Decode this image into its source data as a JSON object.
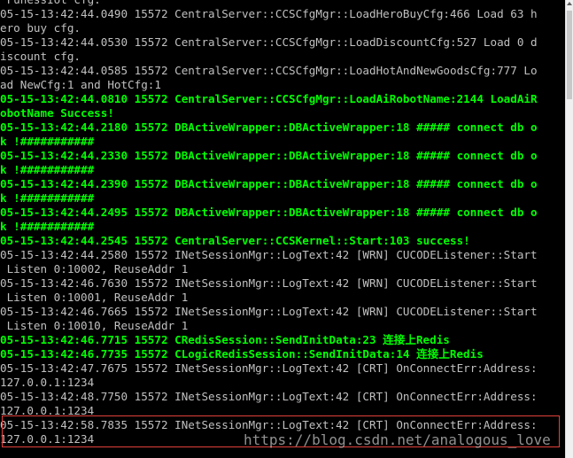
{
  "console": {
    "lines": [
      {
        "text": " FunessIot cfg.",
        "color": "gray"
      },
      {
        "text": "05-15-13:42:44.0490 15572 CentralServer::CCSCfgMgr::LoadHeroBuyCfg:466 Load 63 h",
        "color": "gray"
      },
      {
        "text": "ero buy cfg.",
        "color": "gray"
      },
      {
        "text": "05-15-13:42:44.0530 15572 CentralServer::CCSCfgMgr::LoadDiscountCfg:527 Load 0 d",
        "color": "gray"
      },
      {
        "text": "iscount cfg.",
        "color": "gray"
      },
      {
        "text": "05-15-13:42:44.0585 15572 CentralServer::CCSCfgMgr::LoadHotAndNewGoodsCfg:777 Lo",
        "color": "gray"
      },
      {
        "text": "ad NewCfg:1 and HotCfg:1",
        "color": "gray"
      },
      {
        "text": "05-15-13:42:44.0810 15572 CentralServer::CCSCfgMgr::LoadAiRobotName:2144 LoadAiR",
        "color": "green"
      },
      {
        "text": "obotName Success!",
        "color": "green"
      },
      {
        "text": "05-15-13:42:44.2180 15572 DBActiveWrapper::DBActiveWrapper:18 ##### connect db o",
        "color": "green"
      },
      {
        "text": "k !###########",
        "color": "green"
      },
      {
        "text": "05-15-13:42:44.2330 15572 DBActiveWrapper::DBActiveWrapper:18 ##### connect db o",
        "color": "green"
      },
      {
        "text": "k !###########",
        "color": "green"
      },
      {
        "text": "05-15-13:42:44.2390 15572 DBActiveWrapper::DBActiveWrapper:18 ##### connect db o",
        "color": "green"
      },
      {
        "text": "k !###########",
        "color": "green"
      },
      {
        "text": "05-15-13:42:44.2495 15572 DBActiveWrapper::DBActiveWrapper:18 ##### connect db o",
        "color": "green"
      },
      {
        "text": "k !###########",
        "color": "green"
      },
      {
        "text": "05-15-13:42:44.2545 15572 CentralServer::CCSKernel::Start:103 success!",
        "color": "green"
      },
      {
        "text": "05-15-13:42:44.2580 15572 INetSessionMgr::LogText:42 [WRN] CUCODEListener::Start",
        "color": "gray"
      },
      {
        "text": " Listen 0:10002, ReuseAddr 1",
        "color": "gray"
      },
      {
        "text": "05-15-13:42:46.7630 15572 INetSessionMgr::LogText:42 [WRN] CUCODEListener::Start",
        "color": "gray"
      },
      {
        "text": " Listen 0:10001, ReuseAddr 1",
        "color": "gray"
      },
      {
        "text": "05-15-13:42:46.7665 15572 INetSessionMgr::LogText:42 [WRN] CUCODEListener::Start",
        "color": "gray"
      },
      {
        "text": " Listen 0:10010, ReuseAddr 1",
        "color": "gray"
      },
      {
        "text": "05-15-13:42:46.7715 15572 CRedisSession::SendInitData:23 连接上Redis",
        "color": "green"
      },
      {
        "text": "05-15-13:42:46.7735 15572 CLogicRedisSession::SendInitData:14 连接上Redis",
        "color": "green"
      },
      {
        "text": "05-15-13:42:47.7675 15572 INetSessionMgr::LogText:42 [CRT] OnConnectErr:Address:",
        "color": "gray"
      },
      {
        "text": "127.0.0.1:1234",
        "color": "gray"
      },
      {
        "text": "05-15-13:42:48.7750 15572 INetSessionMgr::LogText:42 [CRT] OnConnectErr:Address:",
        "color": "gray"
      },
      {
        "text": "127.0.0.1:1234",
        "color": "gray"
      },
      {
        "text": "05-15-13:42:58.7835 15572 INetSessionMgr::LogText:42 [CRT] OnConnectErr:Address:",
        "color": "gray"
      },
      {
        "text": "127.0.0.1:1234",
        "color": "gray"
      }
    ]
  },
  "watermark": {
    "text": "https://blog.csdn.net/analogous_love"
  },
  "colors": {
    "background": "#000000",
    "gray_text": "#c0c0c0",
    "green_text": "#00ff00",
    "highlight_border": "#e2403a"
  }
}
